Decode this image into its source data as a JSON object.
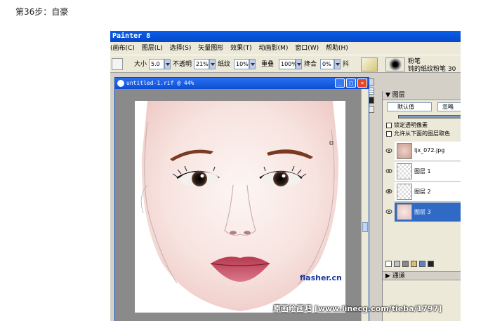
{
  "page": {
    "heading": "第36步：自豪"
  },
  "app": {
    "title": "Painter 8",
    "menu": [
      "(画布(C)",
      "图层(L)",
      "选择(S)",
      "矢量图形",
      "效果(T)",
      "动画影(M)",
      "窗口(W)",
      "帮助(H)"
    ]
  },
  "toolbar": {
    "size_label": "大小",
    "size_value": "5.0",
    "opacity_label": "不透明",
    "opacity_value": "21%",
    "grain_label": "纸纹",
    "grain_value": "10%",
    "resat_label": "重叠",
    "resat_value": "100%",
    "bleed_label": "搀合",
    "bleed_value": "0%",
    "jitter_label": "抖",
    "brush_category": "粉笔",
    "brush_variant": "钝的纸纹粉笔 30"
  },
  "document": {
    "title": "untitled-1.rif @ 44%"
  },
  "layers_panel": {
    "title": "图层",
    "blend_mode": "默认值",
    "composite": "忽略",
    "option1": "锁定透明像素",
    "option2": "允许从下面的图层取色",
    "layers": [
      {
        "name": "ljx_072.jpg"
      },
      {
        "name": "图层 1"
      },
      {
        "name": "图层 2"
      },
      {
        "name": "图层 3"
      }
    ],
    "channels_label": "通道"
  },
  "watermark": {
    "site": "flasher.cn",
    "credit": "原画绘画吧 [www.linecg.com/tieba/1797]"
  },
  "colors": {
    "selection": "#316ac5",
    "titlebar": "#0a5ee8",
    "lips": "#b8394f"
  }
}
